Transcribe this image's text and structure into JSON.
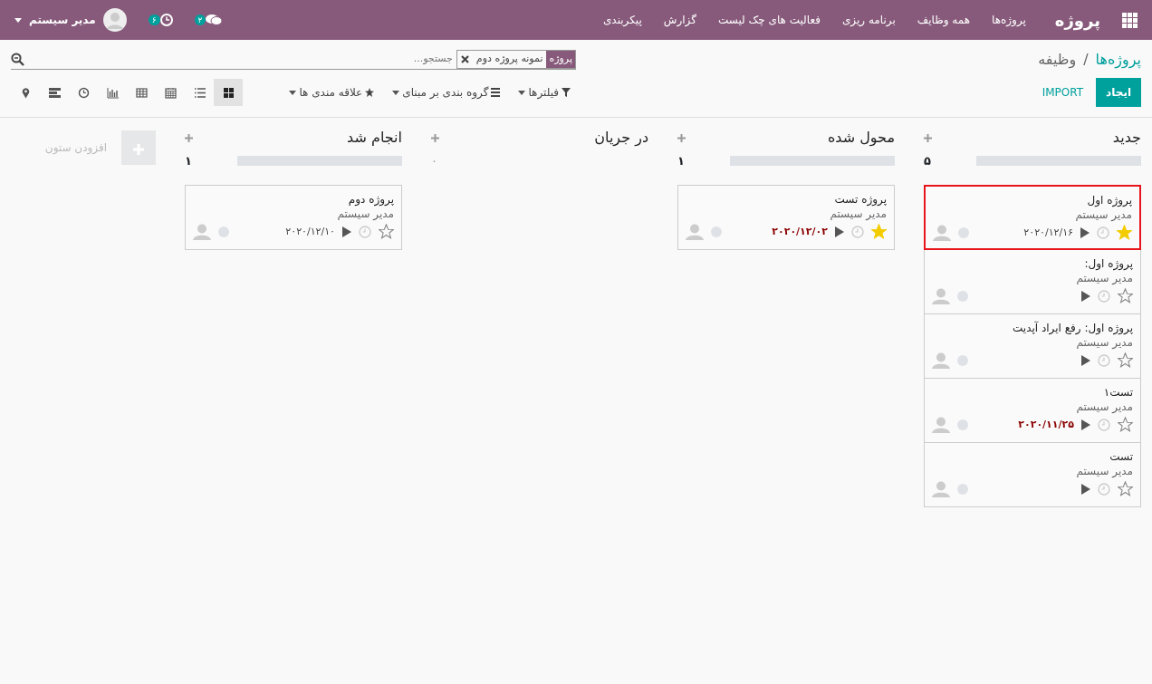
{
  "navbar": {
    "brand": "پروژه",
    "menu": [
      "پروژه‌ها",
      "همه وظایف",
      "برنامه ریزی",
      "فعالیت های چک لیست",
      "گزارش",
      "پیکربندی"
    ],
    "messages_count": "۲",
    "activities_count": "۶",
    "user": "مدیر سیستم"
  },
  "breadcrumb": [
    {
      "label": "پروژه‌ها",
      "link": true
    },
    {
      "label": "وظیفه",
      "link": false
    }
  ],
  "breadcrumb_separator": "/",
  "search": {
    "facet_label": "پروژه",
    "facet_value": "نمونه پروژه دوم",
    "placeholder": "جستجو..."
  },
  "buttons": {
    "create": "ایجاد",
    "import": "IMPORT"
  },
  "filters": [
    {
      "kind": "filter",
      "label": "فیلترها"
    },
    {
      "kind": "group",
      "label": "گروه بندی بر مبنای"
    },
    {
      "kind": "favorite",
      "label": "علاقه مندی ها"
    }
  ],
  "views": [
    {
      "kind": "kanban",
      "selected": true
    },
    {
      "kind": "list",
      "selected": false
    },
    {
      "kind": "calendar",
      "selected": false
    },
    {
      "kind": "pivot",
      "selected": false
    },
    {
      "kind": "graph",
      "selected": false
    },
    {
      "kind": "activity",
      "selected": false
    },
    {
      "kind": "gantt",
      "selected": false
    },
    {
      "kind": "map",
      "selected": false
    }
  ],
  "columns": [
    {
      "title": "جدید",
      "count": "۵",
      "progress_bar": true,
      "cards": [
        {
          "title": "پروژه اول",
          "assignee": "مدیر سیستم",
          "date": "۲۰۲۰/۱۲/۱۶",
          "overdue": false,
          "starred": true,
          "selected": true
        },
        {
          "title": "پروژه اول:",
          "assignee": "مدیر سیستم",
          "starred": false,
          "selected": false
        },
        {
          "title": "پروژه اول: رفع ایراد آپدیت",
          "assignee": "مدیر سیستم",
          "starred": false,
          "selected": false
        },
        {
          "title": "تست۱",
          "assignee": "مدیر سیستم",
          "date": "۲۰۲۰/۱۱/۲۵",
          "overdue": true,
          "starred": false,
          "selected": false
        },
        {
          "title": "تست",
          "assignee": "مدیر سیستم",
          "starred": false,
          "selected": false
        }
      ]
    },
    {
      "title": "محول شده",
      "count": "۱",
      "progress_bar": true,
      "cards": [
        {
          "title": "پروژه تست",
          "assignee": "مدیر سیستم",
          "date": "۲۰۲۰/۱۲/۰۲",
          "overdue": true,
          "starred": true,
          "selected": false
        }
      ]
    },
    {
      "title": "در جریان",
      "count": "۰",
      "progress_bar": false
    },
    {
      "title": "انجام شد",
      "count": "۱",
      "progress_bar": true,
      "cards": [
        {
          "title": "پروژه دوم",
          "assignee": "مدیر سیستم",
          "date": "۲۰۲۰/۱۲/۱۰",
          "overdue": false,
          "starred": false,
          "selected": false
        }
      ]
    }
  ],
  "add_column": "افزودن ستون"
}
